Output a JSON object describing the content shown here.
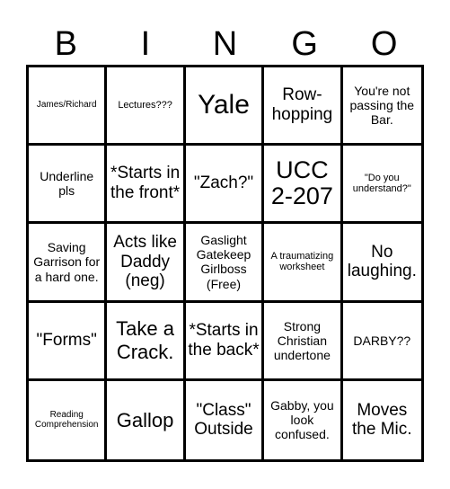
{
  "header": {
    "letters": [
      "B",
      "I",
      "N",
      "G",
      "O"
    ]
  },
  "board": {
    "rows": [
      [
        "James/Richard",
        "Lectures???",
        "Yale",
        "Row-hopping",
        "You're not passing the Bar."
      ],
      [
        "Underline pls",
        "*Starts in the front*",
        "\"Zach?\"",
        "UCC 2-207",
        "\"Do you understand?\""
      ],
      [
        "Saving Garrison for a hard one.",
        "Acts like Daddy (neg)",
        "Gaslight Gatekeep Girlboss (Free)",
        "A traumatizing worksheet",
        "No laughing."
      ],
      [
        "\"Forms\"",
        "Take a Crack.",
        "*Starts in the back*",
        "Strong Christian undertone",
        "DARBY??"
      ],
      [
        "Reading Comprehension",
        "Gallop",
        "\"Class\" Outside",
        "Gabby, you look confused.",
        "Moves the Mic."
      ]
    ]
  }
}
